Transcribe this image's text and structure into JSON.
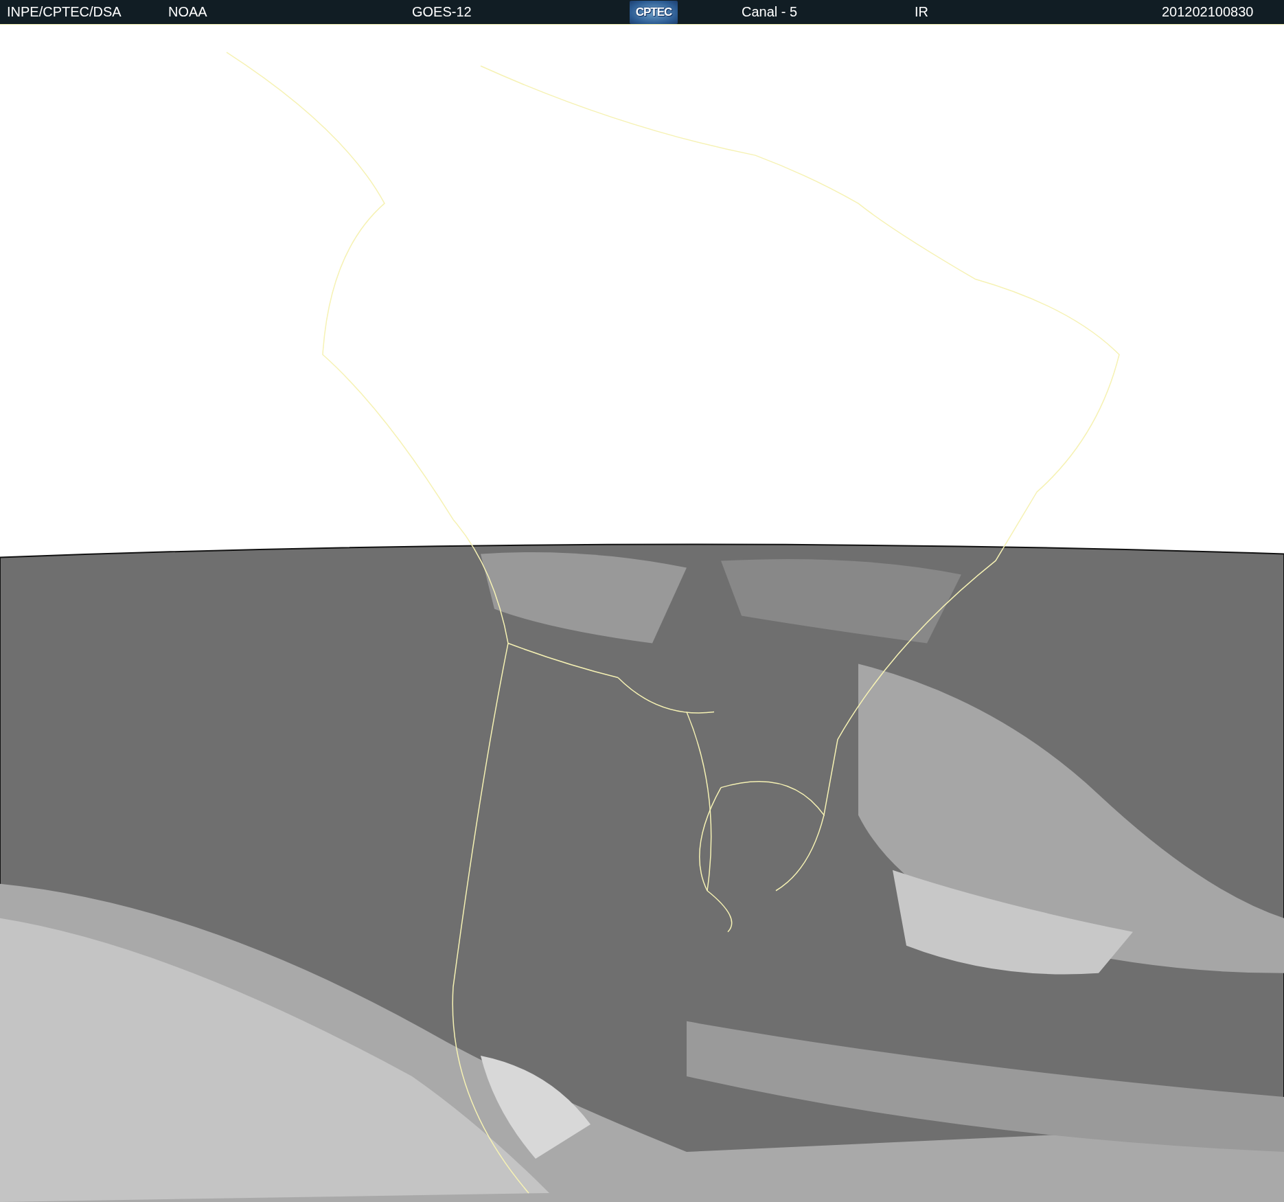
{
  "header": {
    "items": [
      {
        "kind": "text",
        "text": "INPE/CPTEC/DSA"
      },
      {
        "kind": "text",
        "text": "NOAA"
      },
      {
        "kind": "text",
        "text": "GOES-12"
      },
      {
        "kind": "logo",
        "text": "CPTEC"
      },
      {
        "kind": "text",
        "text": "Canal - 5"
      },
      {
        "kind": "text",
        "text": "IR"
      },
      {
        "kind": "text",
        "text": "201202100830"
      }
    ]
  }
}
